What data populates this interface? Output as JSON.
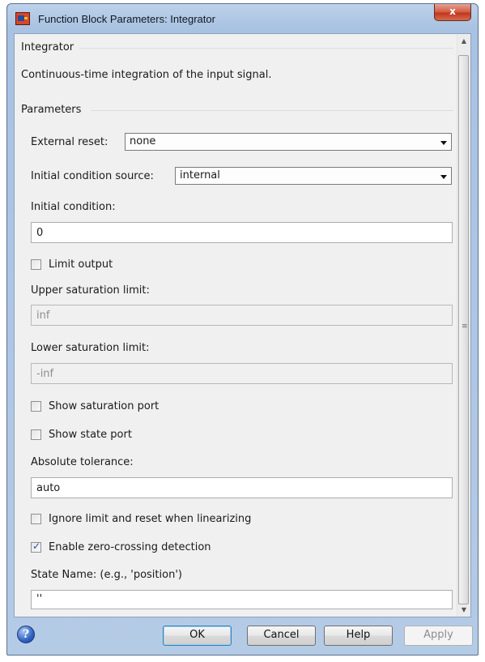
{
  "window": {
    "title": "Function Block Parameters: Integrator",
    "close_glyph": "x"
  },
  "block": {
    "name": "Integrator",
    "description": "Continuous-time integration of the input signal."
  },
  "parameters": {
    "section_label": "Parameters",
    "external_reset": {
      "label": "External reset:",
      "value": "none"
    },
    "initial_condition_source": {
      "label": "Initial condition source:",
      "value": "internal"
    },
    "initial_condition": {
      "label": "Initial condition:",
      "value": "0"
    },
    "limit_output": {
      "label": "Limit output",
      "checked": false
    },
    "upper_saturation": {
      "label": "Upper saturation limit:",
      "value": "inf"
    },
    "lower_saturation": {
      "label": "Lower saturation limit:",
      "value": "-inf"
    },
    "show_saturation_port": {
      "label": "Show saturation port",
      "checked": false
    },
    "show_state_port": {
      "label": "Show state port",
      "checked": false
    },
    "absolute_tolerance": {
      "label": "Absolute tolerance:",
      "value": "auto"
    },
    "ignore_limit": {
      "label": "Ignore limit and reset when linearizing",
      "checked": false
    },
    "zero_crossing": {
      "label": "Enable zero-crossing detection",
      "checked": true
    },
    "state_name": {
      "label": "State Name: (e.g., 'position')",
      "value": "''"
    }
  },
  "buttons": {
    "help_glyph": "?",
    "ok": "OK",
    "cancel": "Cancel",
    "help": "Help",
    "apply": "Apply"
  },
  "icons": {
    "app": "simulink-block-icon",
    "help": "help-question-icon",
    "dropdown": "chevron-down-icon",
    "scroll_up": "scroll-up-icon",
    "scroll_down": "scroll-down-icon",
    "check": "checkmark-icon"
  },
  "colors": {
    "title_bar": "#b4cbe6",
    "client": "#f0f0f0",
    "close": "#c0361c",
    "check": "#2f4fa8"
  }
}
